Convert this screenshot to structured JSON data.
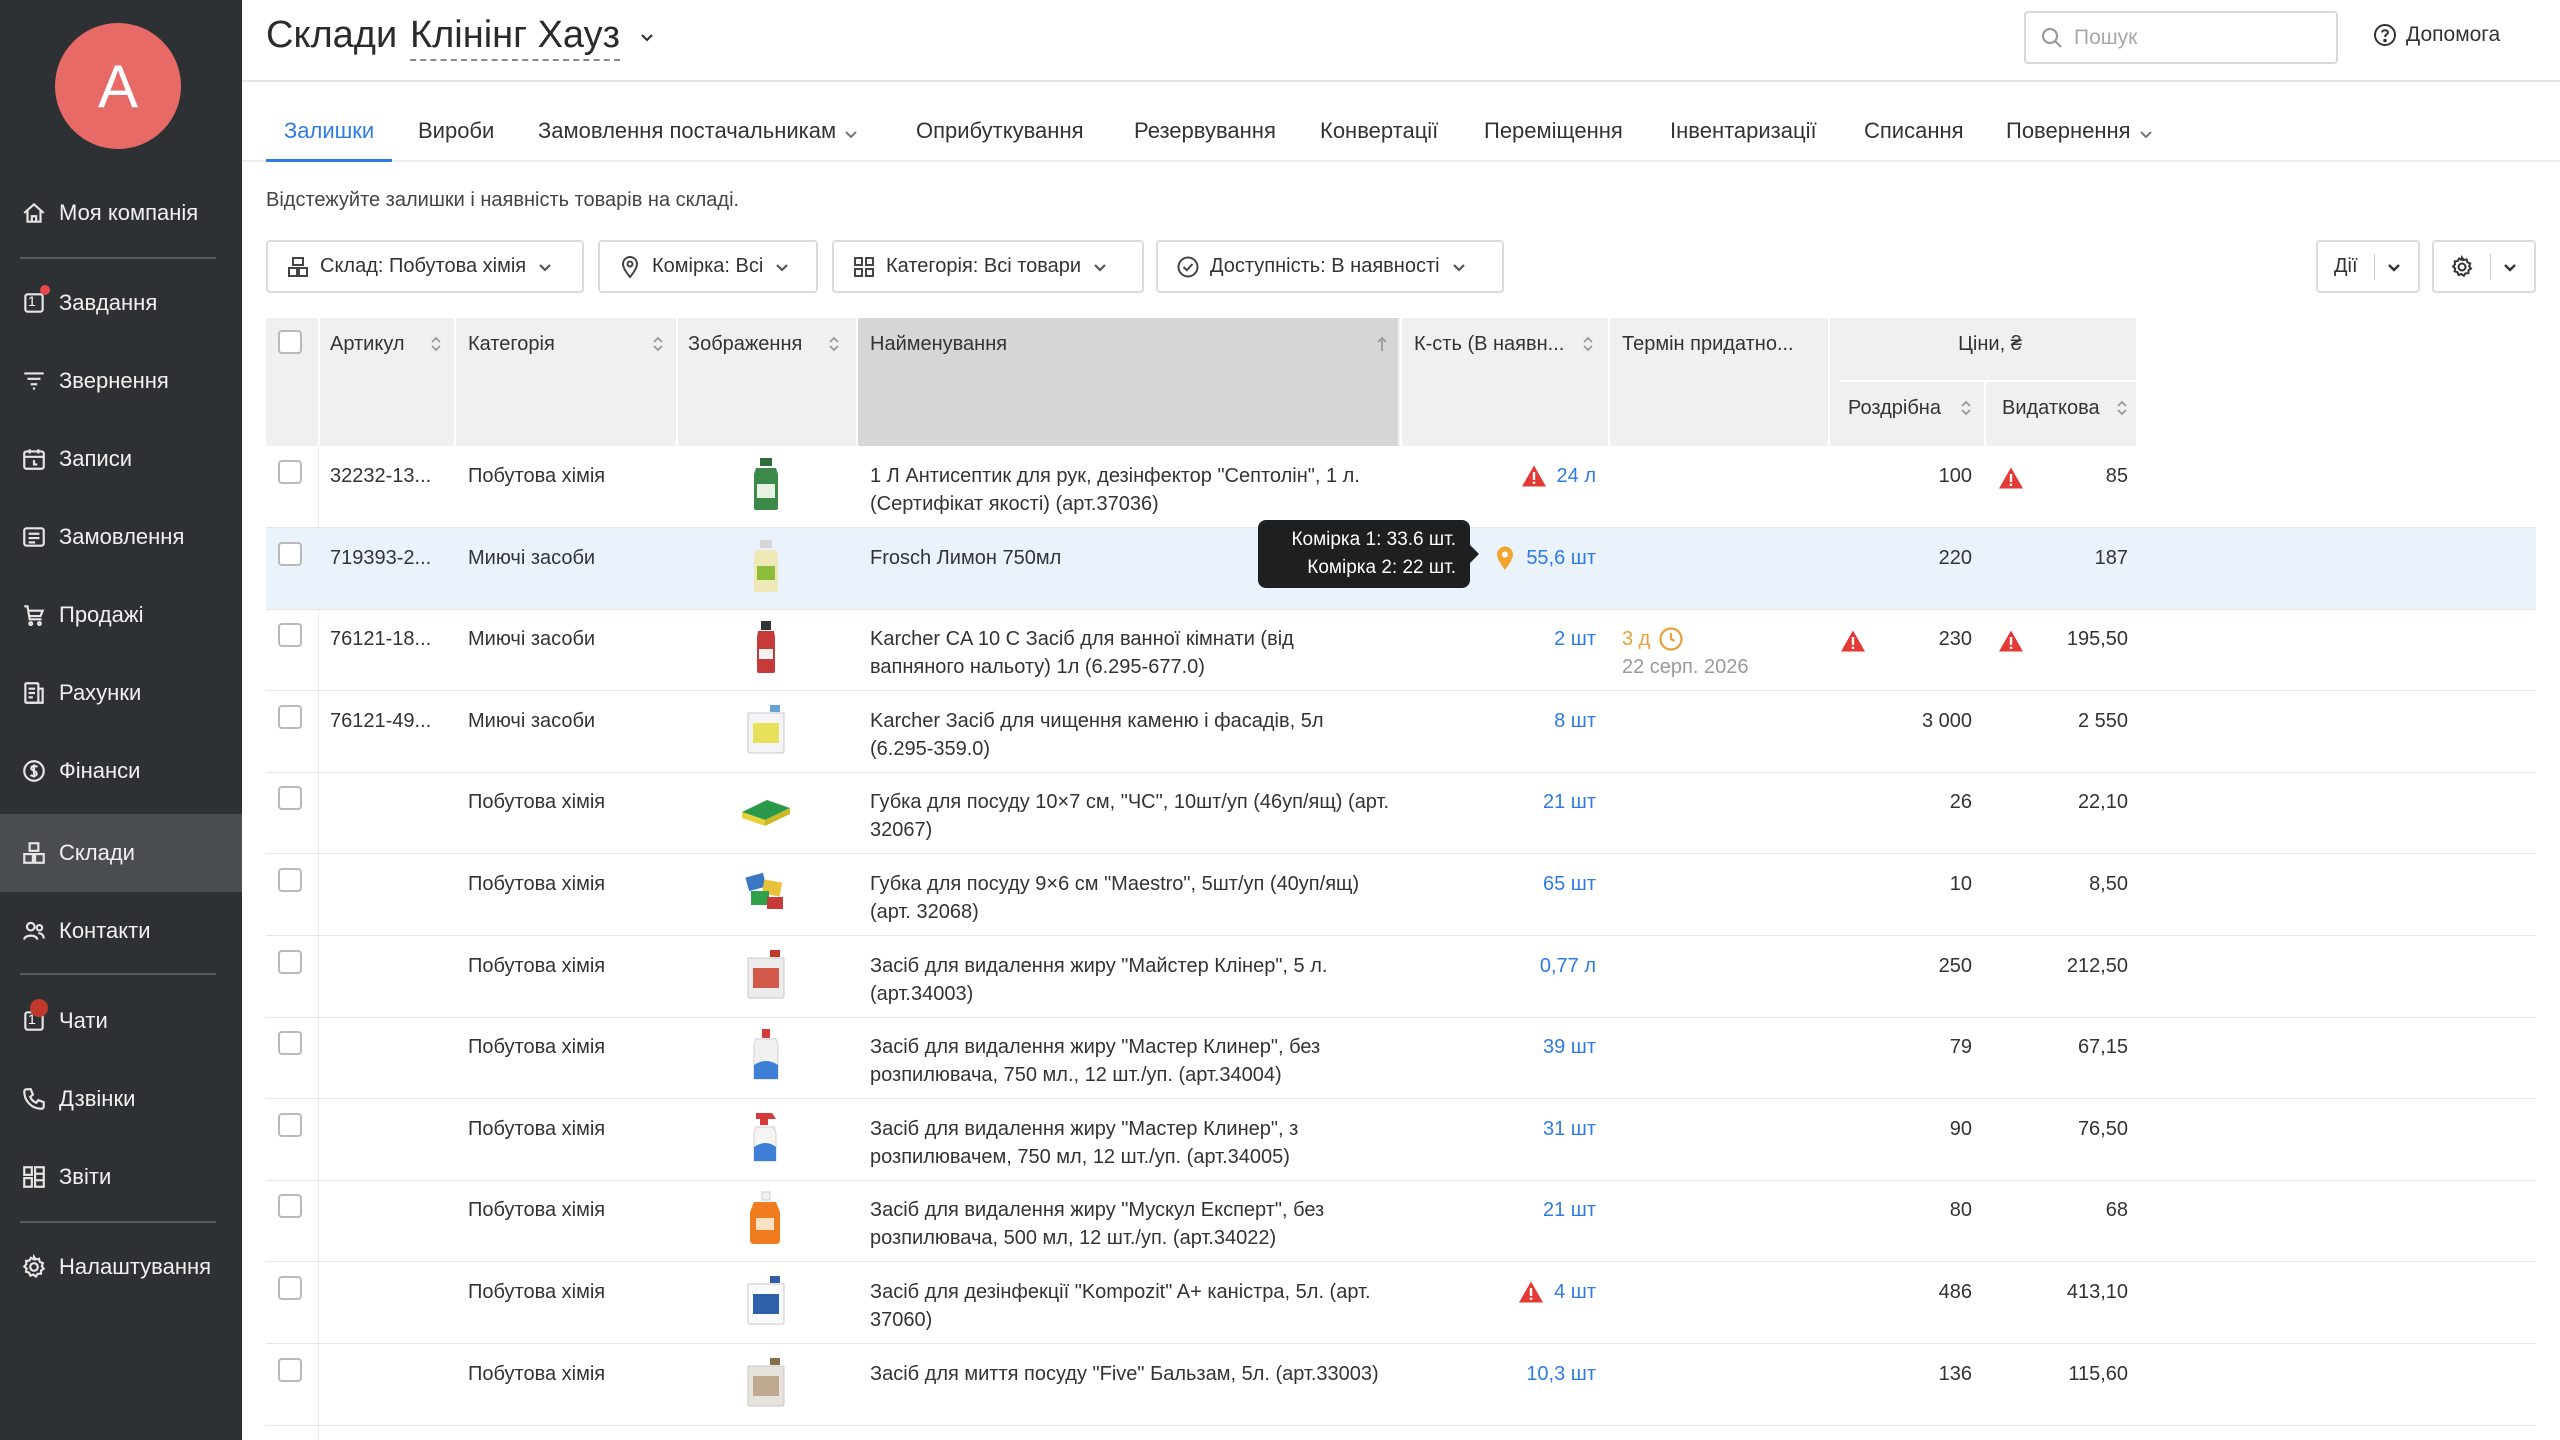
{
  "app": {
    "avatar_letter": "A",
    "title": "Склади",
    "company": "Клінінг Хауз",
    "search_placeholder": "Пошук",
    "help_label": "Допомога"
  },
  "sidebar": {
    "items": [
      {
        "label": "Моя компанія",
        "icon": "home-icon"
      },
      {
        "label": "Завдання",
        "icon": "tasks-icon",
        "badge": "1"
      },
      {
        "label": "Звернення",
        "icon": "funnel-icon"
      },
      {
        "label": "Записи",
        "icon": "calendar-icon"
      },
      {
        "label": "Замовлення",
        "icon": "orders-icon"
      },
      {
        "label": "Продажі",
        "icon": "cart-icon"
      },
      {
        "label": "Рахунки",
        "icon": "invoice-icon"
      },
      {
        "label": "Фінанси",
        "icon": "coin-icon"
      },
      {
        "label": "Склади",
        "icon": "warehouse-icon"
      },
      {
        "label": "Контакти",
        "icon": "contacts-icon"
      },
      {
        "label": "Чати",
        "icon": "chat-icon",
        "badge": "1"
      },
      {
        "label": "Дзвінки",
        "icon": "phone-icon"
      },
      {
        "label": "Звіти",
        "icon": "reports-icon"
      },
      {
        "label": "Налаштування",
        "icon": "gear-icon"
      }
    ],
    "active": "Склади"
  },
  "tabs": [
    {
      "label": "Залишки",
      "active": true
    },
    {
      "label": "Вироби"
    },
    {
      "label": "Замовлення постачальникам",
      "dropdown": true
    },
    {
      "label": "Оприбуткування"
    },
    {
      "label": "Резервування"
    },
    {
      "label": "Конвертації"
    },
    {
      "label": "Переміщення"
    },
    {
      "label": "Інвентаризації"
    },
    {
      "label": "Списання"
    },
    {
      "label": "Повернення",
      "dropdown": true
    }
  ],
  "subtitle": "Відстежуйте залишки і наявність товарів на складі.",
  "filters": {
    "warehouse": "Склад: Побутова хімія",
    "cell": "Комірка: Всі",
    "category": "Категорія: Всі товари",
    "availability": "Доступність: В наявності",
    "actions": "Дії"
  },
  "table": {
    "headers": {
      "sku": "Артикул",
      "category": "Категорія",
      "image": "Зображення",
      "name": "Найменування",
      "qty": "К-сть (В наявн...",
      "expiry": "Термін придатно...",
      "prices": "Ціни, ₴",
      "retail": "Роздрібна",
      "expense": "Видаткова"
    },
    "rows": [
      {
        "sku": "32232-13...",
        "category": "Побутова хімія",
        "name": "1 Л Антисептик для рук, дезінфектор \"Септолін\", 1 л. (Сертифікат якості) (арт.37036)",
        "qty": "24 л",
        "qty_warn": true,
        "retail": "100",
        "expense": "85",
        "expense_warn": true,
        "img": "bottle-green"
      },
      {
        "sku": "719393-2...",
        "category": "Миючі засоби",
        "name": "Frosch Лимон 750мл",
        "qty": "55,6 шт",
        "qty_pin": true,
        "retail": "220",
        "expense": "187",
        "img": "bottle-yellow"
      },
      {
        "sku": "76121-18...",
        "category": "Миючі засоби",
        "name": "Karcher CA 10 C Засіб для ванної кімнати (від вапняного нальоту) 1л (6.295-677.0)",
        "qty": "2 шт",
        "expiry_days": "3 д",
        "expiry_date": "22 серп. 2026",
        "retail": "230",
        "retail_warn": true,
        "expense": "195,50",
        "expense_warn": true,
        "img": "bottle-red"
      },
      {
        "sku": "76121-49...",
        "category": "Миючі засоби",
        "name": "Karcher Засіб для чищення каменю і фасадів, 5л (6.295-359.0)",
        "qty": "8 шт",
        "retail": "3 000",
        "expense": "2 550",
        "img": "canister"
      },
      {
        "sku": "",
        "category": "Побутова хімія",
        "name": "Губка для посуду 10×7 см, \"ЧС\", 10шт/уп (46уп/ящ) (арт. 32067)",
        "qty": "21 шт",
        "retail": "26",
        "expense": "22,10",
        "img": "sponge"
      },
      {
        "sku": "",
        "category": "Побутова хімія",
        "name": "Губка для посуду 9×6 см \"Maestro\", 5шт/уп (40уп/ящ) (арт. 32068)",
        "qty": "65 шт",
        "retail": "10",
        "expense": "8,50",
        "img": "sponges"
      },
      {
        "sku": "",
        "category": "Побутова хімія",
        "name": "Засіб для видалення жиру \"Майстер Клінер\", 5 л. (арт.34003)",
        "qty": "0,77 л",
        "retail": "250",
        "expense": "212,50",
        "img": "canister-red"
      },
      {
        "sku": "",
        "category": "Побутова хімія",
        "name": "Засіб для видалення жиру \"Мастер Клинер\", без розпилювача, 750 мл., 12 шт./уп. (арт.34004)",
        "qty": "39 шт",
        "retail": "79",
        "expense": "67,15",
        "img": "bottle-blue"
      },
      {
        "sku": "",
        "category": "Побутова хімія",
        "name": "Засіб для видалення жиру \"Мастер Клинер\", з розпилювачем, 750 мл, 12 шт./уп. (арт.34005)",
        "qty": "31 шт",
        "retail": "90",
        "expense": "76,50",
        "img": "spray"
      },
      {
        "sku": "",
        "category": "Побутова хімія",
        "name": "Засіб для видалення жиру \"Мускул Експерт\", без розпилювача, 500 мл, 12 шт./уп. (арт.34022)",
        "qty": "21 шт",
        "retail": "80",
        "expense": "68",
        "img": "bottle-orange"
      },
      {
        "sku": "",
        "category": "Побутова хімія",
        "name": "Засіб для дезінфекції \"Kompozit\" A+ каністра, 5л. (арт. 37060)",
        "qty": "4 шт",
        "qty_warn": true,
        "retail": "486",
        "expense": "413,10",
        "img": "canister-white"
      },
      {
        "sku": "",
        "category": "Побутова хімія",
        "name": "Засіб для миття посуду \"Five\" Бальзам, 5л. (арт.33003)",
        "qty": "10,3 шт",
        "retail": "136",
        "expense": "115,60",
        "img": "canister-grey"
      }
    ]
  },
  "tooltip": {
    "line1": "Комірка 1: 33.6 шт.",
    "line2": "Комірка 2: 22 шт."
  },
  "colors": {
    "sidebar": "#2e3134",
    "accent": "#2e7be6",
    "warning": "#e53935",
    "expiry": "#e8a13a",
    "avatar": "#e86a66"
  }
}
